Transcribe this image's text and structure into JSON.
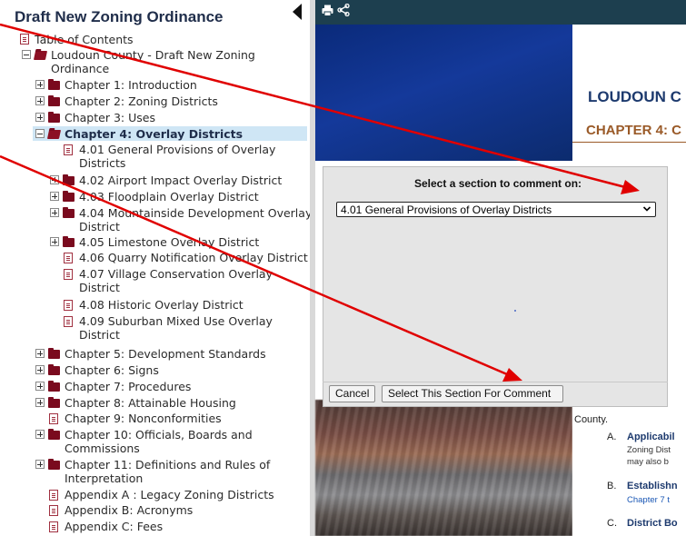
{
  "sidebar": {
    "title": "Draft New Zoning Ordinance",
    "items": [
      {
        "label": "Table of Contents"
      },
      {
        "label": "Loudoun County - Draft New Zoning",
        "cont": "Ordinance"
      },
      {
        "label": "Chapter 1: Introduction"
      },
      {
        "label": "Chapter 2: Zoning Districts"
      },
      {
        "label": "Chapter 3: Uses"
      },
      {
        "label": "Chapter 4: Overlay Districts"
      },
      {
        "label": "4.01 General Provisions of Overlay",
        "cont": "Districts"
      },
      {
        "label": "4.02 Airport Impact Overlay District"
      },
      {
        "label": "4.03 Floodplain Overlay District"
      },
      {
        "label": "4.04 Mountainside Development Overlay",
        "cont": "District"
      },
      {
        "label": "4.05 Limestone Overlay District"
      },
      {
        "label": "4.06 Quarry Notification Overlay District"
      },
      {
        "label": "4.07 Village Conservation Overlay",
        "cont": "District"
      },
      {
        "label": "4.08 Historic Overlay District"
      },
      {
        "label": "4.09 Suburban Mixed Use Overlay",
        "cont": "District"
      },
      {
        "label": "Chapter 5: Development Standards"
      },
      {
        "label": "Chapter 6: Signs"
      },
      {
        "label": "Chapter 7: Procedures"
      },
      {
        "label": "Chapter 8: Attainable Housing"
      },
      {
        "label": "Chapter 9: Nonconformities"
      },
      {
        "label": "Chapter 10: Officials, Boards and",
        "cont": "Commissions"
      },
      {
        "label": "Chapter 11: Definitions and Rules of",
        "cont": "Interpretation"
      },
      {
        "label": "Appendix A : Legacy Zoning Districts"
      },
      {
        "label": "Appendix B: Acronyms"
      },
      {
        "label": "Appendix C: Fees"
      }
    ]
  },
  "document": {
    "heading": "LOUDOUN C",
    "chapter_heading": "CHAPTER 4: C",
    "county_text": "County.",
    "list": [
      {
        "letter": "A.",
        "title": "Applicabil",
        "line1": "Zoning Dist",
        "line2": "may also b"
      },
      {
        "letter": "B.",
        "title": "Establishn",
        "line1": "Chapter 7 t"
      },
      {
        "letter": "C.",
        "title": "District Bo"
      }
    ]
  },
  "dialog": {
    "prompt": "Select a section to comment on:",
    "selected_section": "4.01 General Provisions of Overlay Districts",
    "cancel_label": "Cancel",
    "select_label": "Select This Section For Comment"
  },
  "colors": {
    "toolbar": "#1d3f4f",
    "selected_row": "#cfe6f5",
    "folder": "#7a0a1e",
    "annotation_arrow": "#e00000",
    "doc_heading": "#1d3a6e",
    "chapter_heading": "#9a5a28"
  }
}
